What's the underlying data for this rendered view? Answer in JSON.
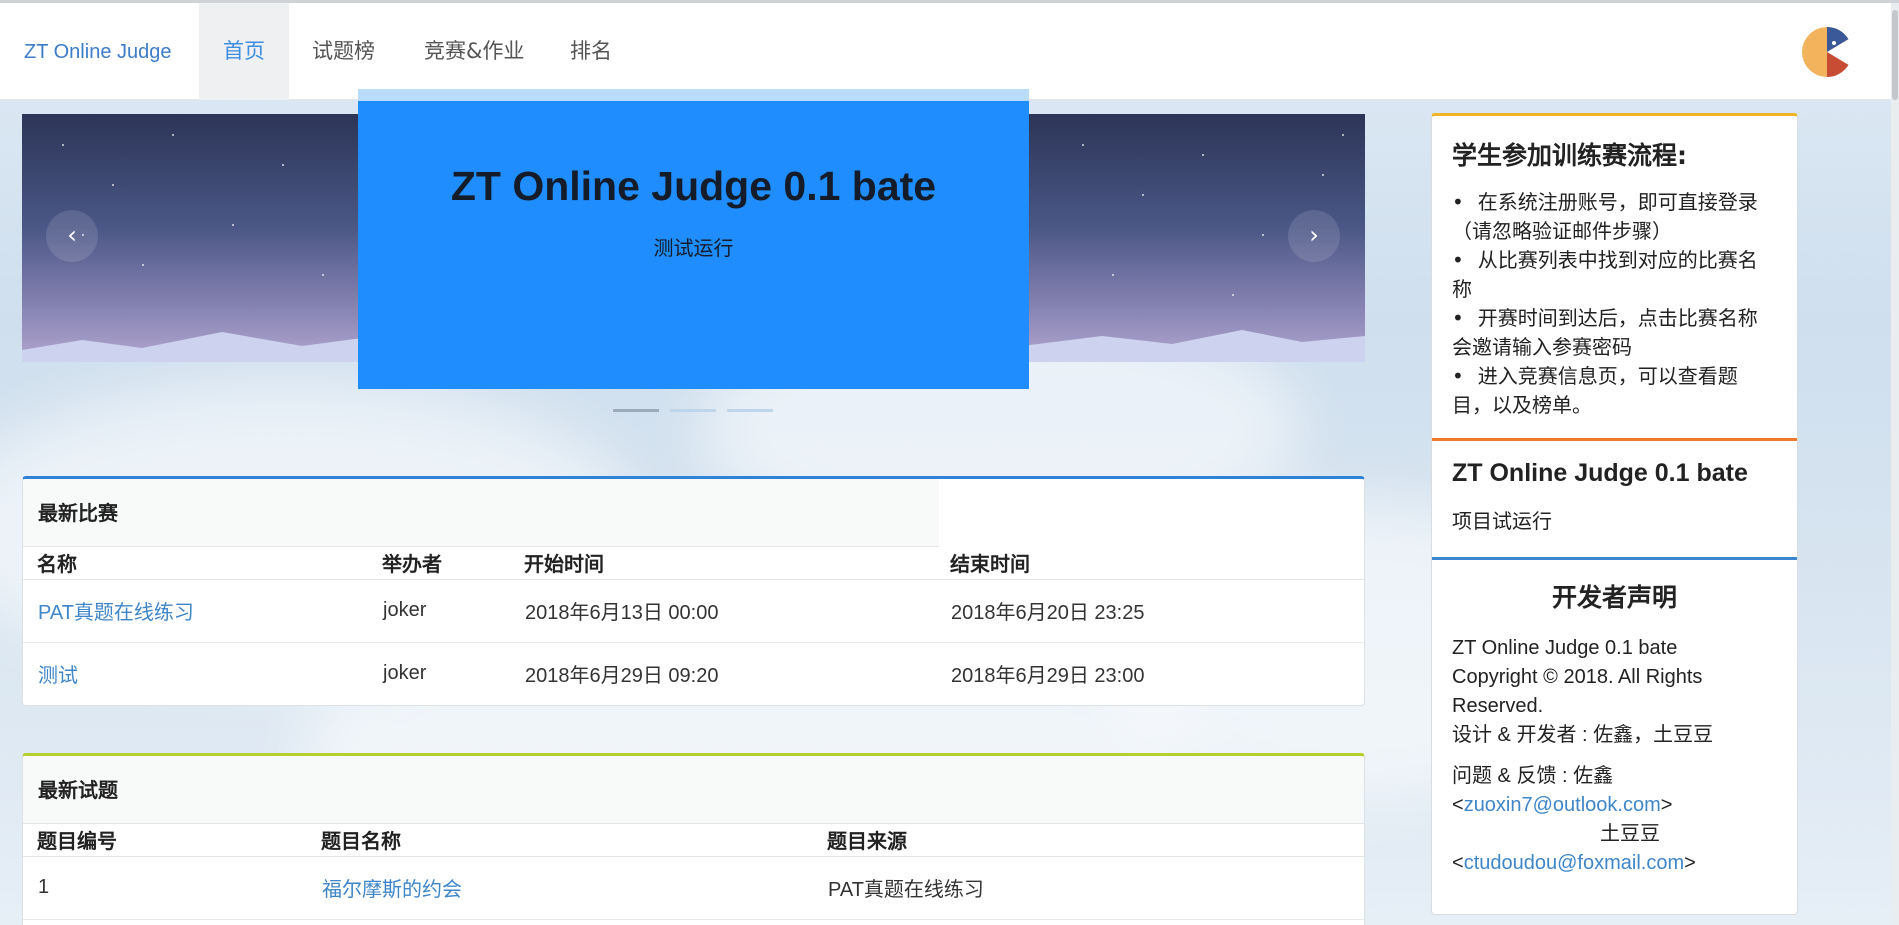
{
  "nav": {
    "brand": "ZT Online Judge",
    "items": [
      {
        "label": "首页",
        "active": true
      },
      {
        "label": "试题榜",
        "active": false
      },
      {
        "label": "竞赛&作业",
        "active": false
      },
      {
        "label": "排名",
        "active": false
      }
    ]
  },
  "carousel": {
    "title": "ZT Online Judge 0.1 bate",
    "subtitle": "测试运行",
    "prev_icon": "chevron-left-icon",
    "next_icon": "chevron-right-icon",
    "prev_glyph": "‹",
    "next_glyph": "›",
    "slides": 3,
    "active_slide": 1
  },
  "contests": {
    "heading": "最新比赛",
    "columns": [
      "名称",
      "举办者",
      "开始时间",
      "结束时间"
    ],
    "rows": [
      {
        "name": "PAT真题在线练习",
        "host": "joker",
        "start": "2018年6月13日 00:00",
        "end": "2018年6月20日 23:25"
      },
      {
        "name": "测试",
        "host": "joker",
        "start": "2018年6月29日 09:20",
        "end": "2018年6月29日 23:00"
      }
    ]
  },
  "problems": {
    "heading": "最新试题",
    "columns": [
      "题目编号",
      "题目名称",
      "题目来源"
    ],
    "rows": [
      {
        "id": "1",
        "name": "福尔摩斯的约会",
        "source": "PAT真题在线练习"
      }
    ]
  },
  "sidebar": {
    "flow_title": "学生参加训练赛流程:",
    "flow_items": [
      "在系统注册账号，即可直接登录（请忽略验证邮件步骤）",
      "从比赛列表中找到对应的比赛名称",
      "开赛时间到达后，点击比赛名称会邀请输入参赛密码",
      "进入竞赛信息页，可以查看题目，以及榜单。"
    ],
    "project_title": "ZT Online Judge 0.1 bate",
    "project_text": "项目试运行",
    "dev_title": "开发者声明",
    "dev_line1": "ZT Online Judge 0.1 bate",
    "dev_line2": "Copyright © 2018. All Rights Reserved.",
    "dev_line3": "设计 & 开发者 : 佐鑫，土豆豆",
    "feedback_line": "问题 & 反馈 : 佐鑫",
    "email1": "zuoxin7@outlook.com",
    "name2": "土豆豆",
    "email2": "ctudoudou@foxmail.com",
    "lt": "<",
    "gt": ">"
  },
  "colors": {
    "accent": "#3d8de0",
    "caption_bg": "#1f8dfe",
    "contests_top": "#2f82d4",
    "problems_top": "#b5cf2e",
    "sidebar_top": "#f0b429"
  }
}
